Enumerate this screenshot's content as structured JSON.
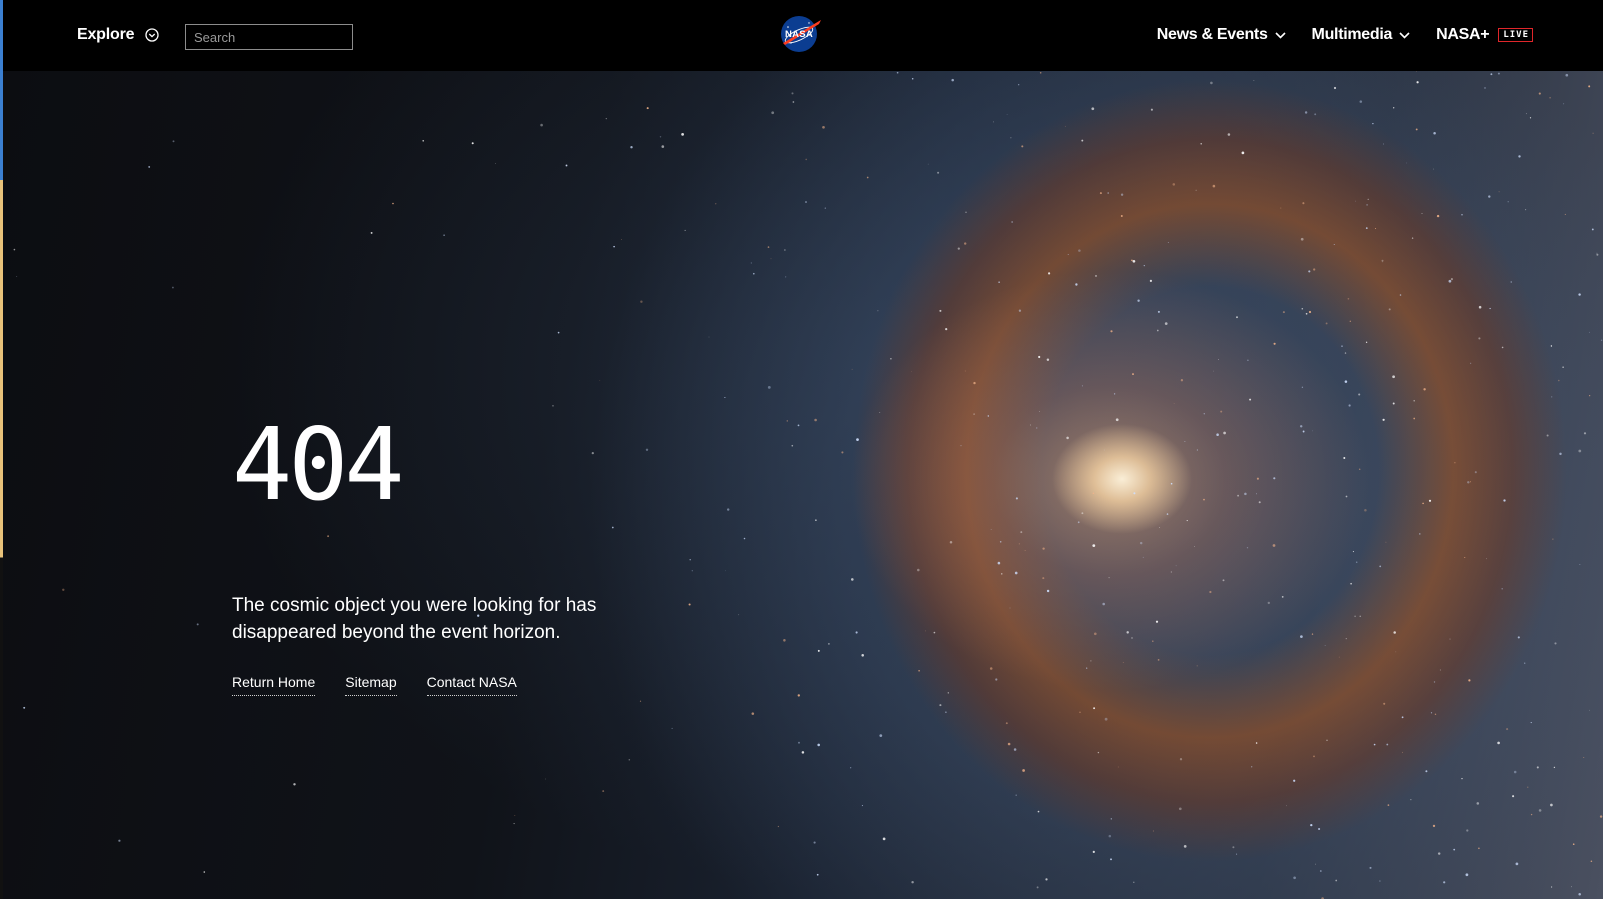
{
  "header": {
    "explore_label": "Explore",
    "explore_icon": "chevron-down-circle-icon",
    "search": {
      "placeholder": "Search",
      "value": ""
    },
    "logo_text": "NASA",
    "nav": [
      {
        "label": "News & Events",
        "icon": "chevron-down-icon"
      },
      {
        "label": "Multimedia",
        "icon": "chevron-down-icon"
      },
      {
        "label": "NASA+",
        "badge": "LIVE"
      }
    ]
  },
  "main": {
    "error_code": "404",
    "message": "The cosmic object you were looking for has disappeared beyond the event horizon.",
    "links": [
      {
        "label": "Return Home"
      },
      {
        "label": "Sitemap"
      },
      {
        "label": "Contact NASA"
      }
    ]
  },
  "colors": {
    "header_bg": "#000000",
    "live_badge_border": "#e0262a",
    "nasa_blue": "#0b3d91",
    "nasa_red": "#fc3d21"
  }
}
